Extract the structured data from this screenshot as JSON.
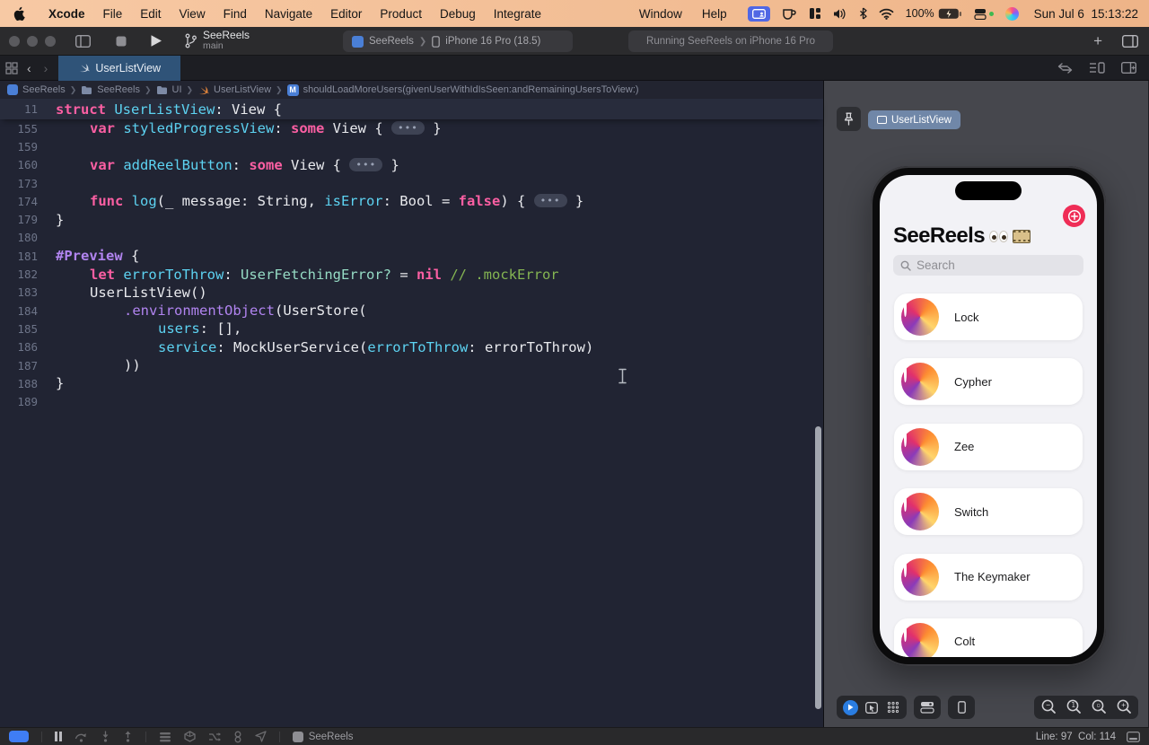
{
  "colors": {
    "menu_gradient_left": "#f7c9a4",
    "menu_gradient_right": "#eeb488",
    "toolbar_bg": "#2b2b2d",
    "tabbar_bg": "#1d1e23",
    "tab_active_bg": "#2f5378",
    "editor_bg": "#212433",
    "pinned_bg": "#282c3c",
    "gutter": "#6d7488",
    "canvas_bg": "#46474d",
    "kw": "#fc5fa3",
    "decl": "#5dd3f2",
    "type": "#96dcc5",
    "comment": "#84b452",
    "preproc": "#b184f0",
    "fn": "#b184f0",
    "plain": "#e9eaee",
    "accent_pink": "#ef2d56",
    "debug_blue": "#3f7df5"
  },
  "menu_bar": {
    "items": [
      "Xcode",
      "File",
      "Edit",
      "View",
      "Find",
      "Navigate",
      "Editor",
      "Product",
      "Debug",
      "Integrate"
    ],
    "right_items": [
      "Window",
      "Help"
    ],
    "battery": "100%",
    "clock": "Sun Jul 6  15:13:22"
  },
  "toolbar": {
    "project": "SeeReels",
    "branch": "main",
    "scheme": "SeeReels",
    "device": "iPhone 16 Pro (18.5)",
    "status": "Running SeeReels on iPhone 16 Pro"
  },
  "tab_bar": {
    "active_tab": "UserListView"
  },
  "breadcrumb": [
    {
      "icon": "app",
      "label": "SeeReels"
    },
    {
      "icon": "folder",
      "label": "SeeReels"
    },
    {
      "icon": "folder",
      "label": "UI"
    },
    {
      "icon": "swift",
      "label": "UserListView"
    },
    {
      "icon": "method",
      "label": "shouldLoadMoreUsers(givenUserWithIdIsSeen:andRemainingUsersToView:)"
    }
  ],
  "editor": {
    "pinned_line": {
      "num": "11",
      "indent": 0,
      "tokens": [
        [
          "kw",
          "struct"
        ],
        [
          "pl",
          " "
        ],
        [
          "decl",
          "UserListView"
        ],
        [
          "pl",
          ": View {"
        ]
      ]
    },
    "lines": [
      {
        "num": "155",
        "indent": 1,
        "tokens": [
          [
            "kw",
            "var"
          ],
          [
            "pl",
            " "
          ],
          [
            "decl",
            "styledProgressView"
          ],
          [
            "pl",
            ": "
          ],
          [
            "kw",
            "some"
          ],
          [
            "pl",
            " View { "
          ],
          [
            "fold",
            "•••"
          ],
          [
            "pl",
            " }"
          ]
        ]
      },
      {
        "num": "159",
        "indent": 0,
        "tokens": []
      },
      {
        "num": "160",
        "indent": 1,
        "tokens": [
          [
            "kw",
            "var"
          ],
          [
            "pl",
            " "
          ],
          [
            "decl",
            "addReelButton"
          ],
          [
            "pl",
            ": "
          ],
          [
            "kw",
            "some"
          ],
          [
            "pl",
            " View { "
          ],
          [
            "fold",
            "•••"
          ],
          [
            "pl",
            " }"
          ]
        ]
      },
      {
        "num": "173",
        "indent": 0,
        "tokens": []
      },
      {
        "num": "174",
        "indent": 1,
        "tokens": [
          [
            "kw",
            "func"
          ],
          [
            "pl",
            " "
          ],
          [
            "decl",
            "log"
          ],
          [
            "pl",
            "(_ message: String, "
          ],
          [
            "decl",
            "isError"
          ],
          [
            "pl",
            ": Bool = "
          ],
          [
            "kw",
            "false"
          ],
          [
            "pl",
            ") { "
          ],
          [
            "fold",
            "•••"
          ],
          [
            "pl",
            " }"
          ]
        ]
      },
      {
        "num": "179",
        "indent": 0,
        "tokens": [
          [
            "pl",
            "}"
          ]
        ]
      },
      {
        "num": "180",
        "indent": 0,
        "tokens": []
      },
      {
        "num": "181",
        "indent": 0,
        "tokens": [
          [
            "pp",
            "#Preview"
          ],
          [
            "pl",
            " {"
          ]
        ]
      },
      {
        "num": "182",
        "indent": 1,
        "tokens": [
          [
            "kw",
            "let"
          ],
          [
            "pl",
            " "
          ],
          [
            "decl",
            "errorToThrow"
          ],
          [
            "pl",
            ": "
          ],
          [
            "type",
            "UserFetchingError?"
          ],
          [
            "pl",
            " = "
          ],
          [
            "kw",
            "nil"
          ],
          [
            "pl",
            " "
          ],
          [
            "cm",
            "// .mockError"
          ]
        ]
      },
      {
        "num": "183",
        "indent": 1,
        "tokens": [
          [
            "pl",
            "UserListView()"
          ]
        ]
      },
      {
        "num": "184",
        "indent": 2,
        "tokens": [
          [
            "fn",
            ".environmentObject"
          ],
          [
            "pl",
            "(UserStore("
          ]
        ]
      },
      {
        "num": "185",
        "indent": 3,
        "tokens": [
          [
            "decl",
            "users"
          ],
          [
            "pl",
            ": [],"
          ]
        ]
      },
      {
        "num": "186",
        "indent": 3,
        "tokens": [
          [
            "decl",
            "service"
          ],
          [
            "pl",
            ": MockUserService("
          ],
          [
            "decl",
            "errorToThrow"
          ],
          [
            "pl",
            ": errorToThrow)"
          ]
        ]
      },
      {
        "num": "187",
        "indent": 2,
        "tokens": [
          [
            "pl",
            "))"
          ]
        ]
      },
      {
        "num": "188",
        "indent": 0,
        "tokens": [
          [
            "pl",
            "}"
          ]
        ]
      },
      {
        "num": "189",
        "indent": 0,
        "tokens": []
      }
    ]
  },
  "preview": {
    "pill_label": "UserListView",
    "phone": {
      "title": "SeeReels",
      "title_emoji": "👀🎞️",
      "search_placeholder": "Search",
      "users": [
        {
          "name": "Lock",
          "c1": "#b9a8a0",
          "c2": "#3a3238"
        },
        {
          "name": "Cypher",
          "c1": "#cfc4b2",
          "c2": "#6f665e"
        },
        {
          "name": "Zee",
          "c1": "#b06a3e",
          "c2": "#5d3420"
        },
        {
          "name": "Switch",
          "c1": "#dcdcd8",
          "c2": "#8f8f8a"
        },
        {
          "name": "The Keymaker",
          "c1": "#6d6458",
          "c2": "#2e2a26"
        },
        {
          "name": "Colt",
          "c1": "#c98f6a",
          "c2": "#7a4a32"
        }
      ]
    }
  },
  "status_bar": {
    "app": "SeeReels",
    "line_label": "Line: 97",
    "col_label": "Col: 114"
  }
}
